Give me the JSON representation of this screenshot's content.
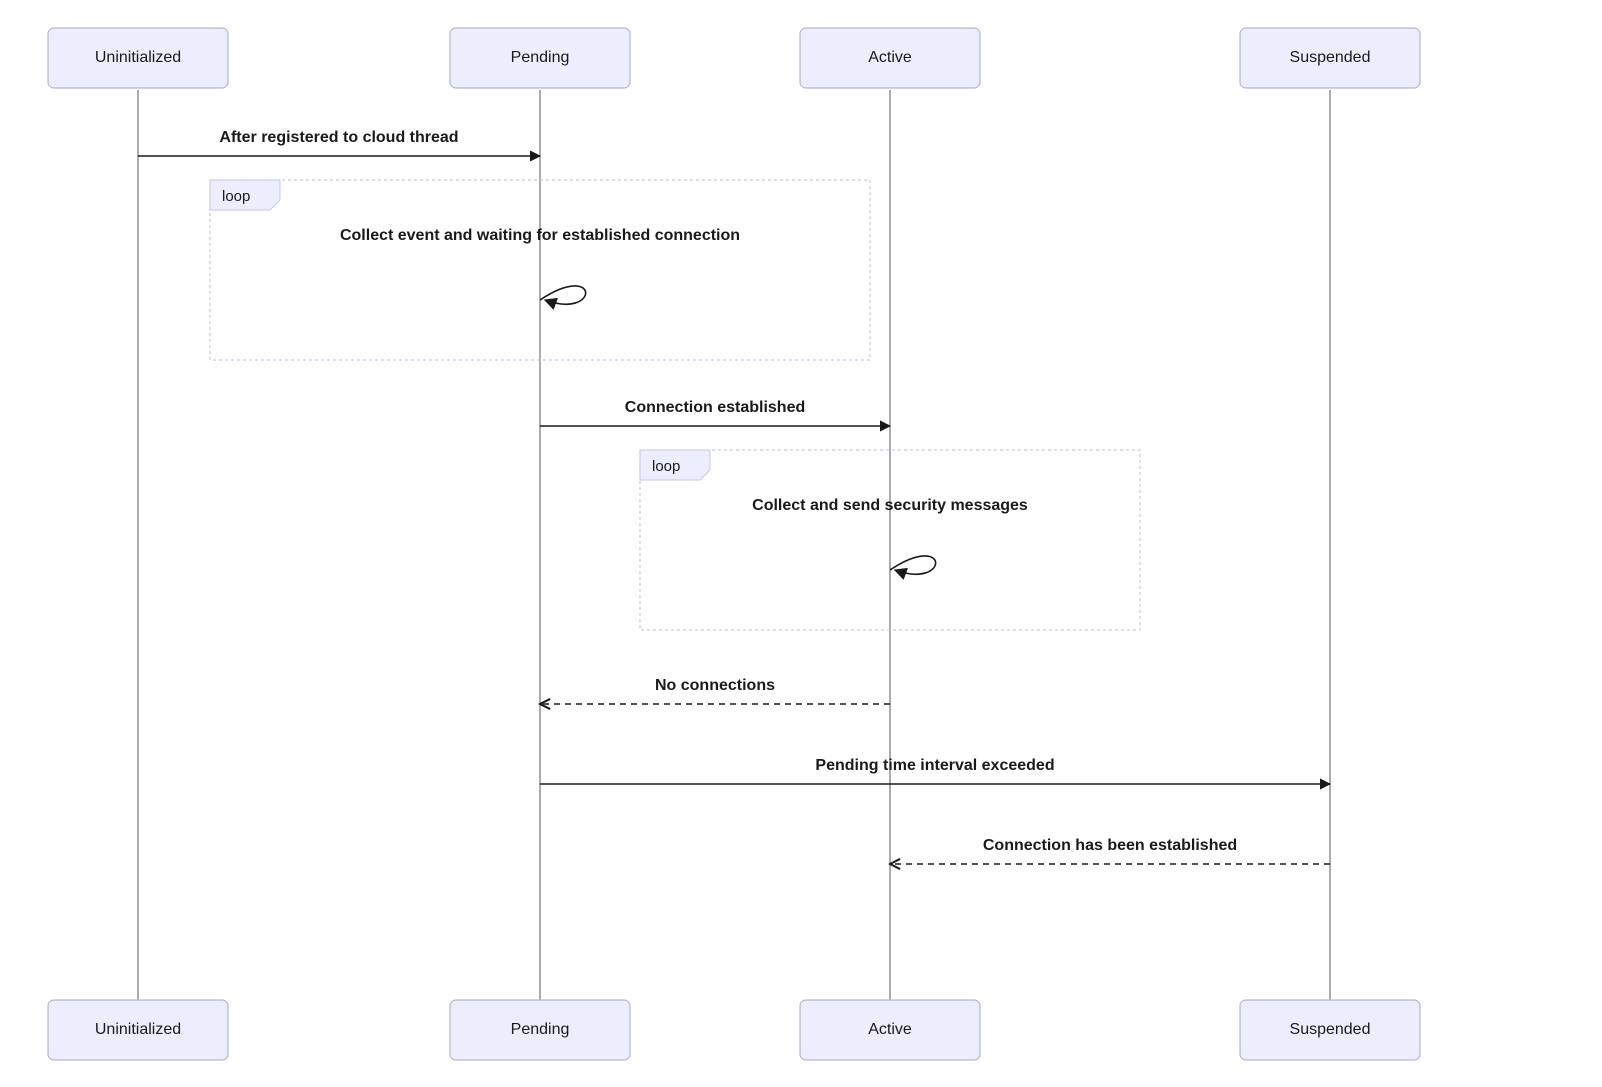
{
  "participants": {
    "p0": "Uninitialized",
    "p1": "Pending",
    "p2": "Active",
    "p3": "Suspended"
  },
  "messages": {
    "m0": "After registered to cloud thread",
    "m1": "Collect event and waiting for established connection",
    "m2": "Connection established",
    "m3": "Collect and send security messages",
    "m4": "No connections",
    "m5": "Pending time interval exceeded",
    "m6": "Connection has been established"
  },
  "fragments": {
    "loop_label": "loop"
  }
}
